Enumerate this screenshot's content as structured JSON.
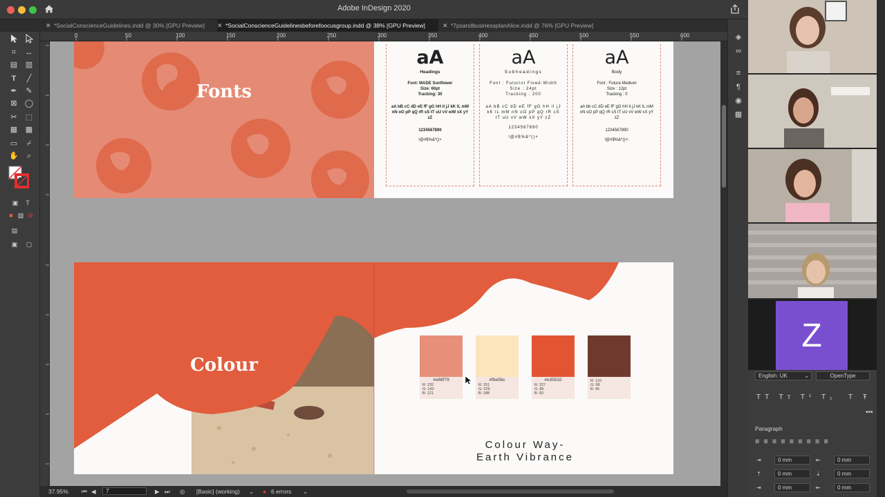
{
  "app": {
    "title": "Adobe InDesign 2020"
  },
  "tabs": [
    {
      "label": "*SocialConscienceGuidelines.indd @ 30% [GPU Preview]"
    },
    {
      "label": "*SocialConscienceGuidelinesbeforefoocusgroup.indd @ 38% [GPU Preview]"
    },
    {
      "label": "*7psandbusinessplanAlice.indd @ 76% [GPU Preview]"
    }
  ],
  "ruler": {
    "marks": [
      "0",
      "50",
      "100",
      "150",
      "200",
      "250",
      "300",
      "350",
      "400",
      "450",
      "500",
      "550",
      "600"
    ]
  },
  "spread1": {
    "left_title": "Fonts",
    "columns": [
      {
        "sample": "aA",
        "heading": "Headings",
        "spec": "Font: MADE Sunflower\nSize: 60pt\nTracking: 30",
        "alphabet": "aA bB cC dD eE fF gG hH iI jJ kK lL mM nN oO pP qQ rR sS tT uU vV wW xX yY zZ",
        "digits": "1234567890",
        "symbols": "!@#$%&*()+"
      },
      {
        "sample": "aA",
        "heading": "Subheadings",
        "spec": "Font : Futurist Fixed-Width\nSize : 24pt\nTracking : 200",
        "alphabet": "aA bB cC dD eE fF gG hH iI jJ kK lL mM nN oO pP qQ rR sS tT uU vV wW xX yY zZ",
        "digits": "1234567890",
        "symbols": "!@#$%&*()+"
      },
      {
        "sample": "aA",
        "heading": "Body",
        "spec": "Font : Futura Medium\nSize : 12pt\nTracking : 0",
        "alphabet": "aA bb cC dD eE fF gG hH iI jJ kK lL mM nN oO pP qQ rR sS tT uU vV wW xX yY zZ",
        "digits": "1234567890",
        "symbols": "!@#$%&*()+:"
      }
    ]
  },
  "spread2": {
    "left_title": "Colour",
    "swatches": [
      {
        "hex": "#e88f79",
        "r": "R: 232",
        "g": "G: 143",
        "b": "B: 121",
        "color": "#e88f79"
      },
      {
        "hex": "#fbe5bc",
        "r": "R: 251",
        "g": "G: 229",
        "b": "B: 188",
        "color": "#fbe5bc"
      },
      {
        "hex": "#e35532",
        "r": "R: 227",
        "g": "G: 85",
        "b": "B: 50",
        "color": "#e35532"
      },
      {
        "hex": "",
        "r": "R: 110",
        "g": "G: 58",
        "b": "B: 45",
        "color": "#6e3a2d"
      }
    ],
    "caption_line1": "Colour Way-",
    "caption_line2": "Earth Vibrance"
  },
  "status": {
    "zoom": "37.95%",
    "page": "7",
    "preflight_profile": "[Basic] (working)",
    "errors": "6 errors"
  },
  "properties": {
    "language": "English: UK",
    "opentype": "OpenType",
    "paragraph_label": "Paragraph",
    "field_value": "0 mm"
  },
  "participant_initial": "Z",
  "colors": {
    "accent_coral": "#e58a74",
    "accent_orange": "#e15d3d",
    "error_red": "#e04040"
  }
}
